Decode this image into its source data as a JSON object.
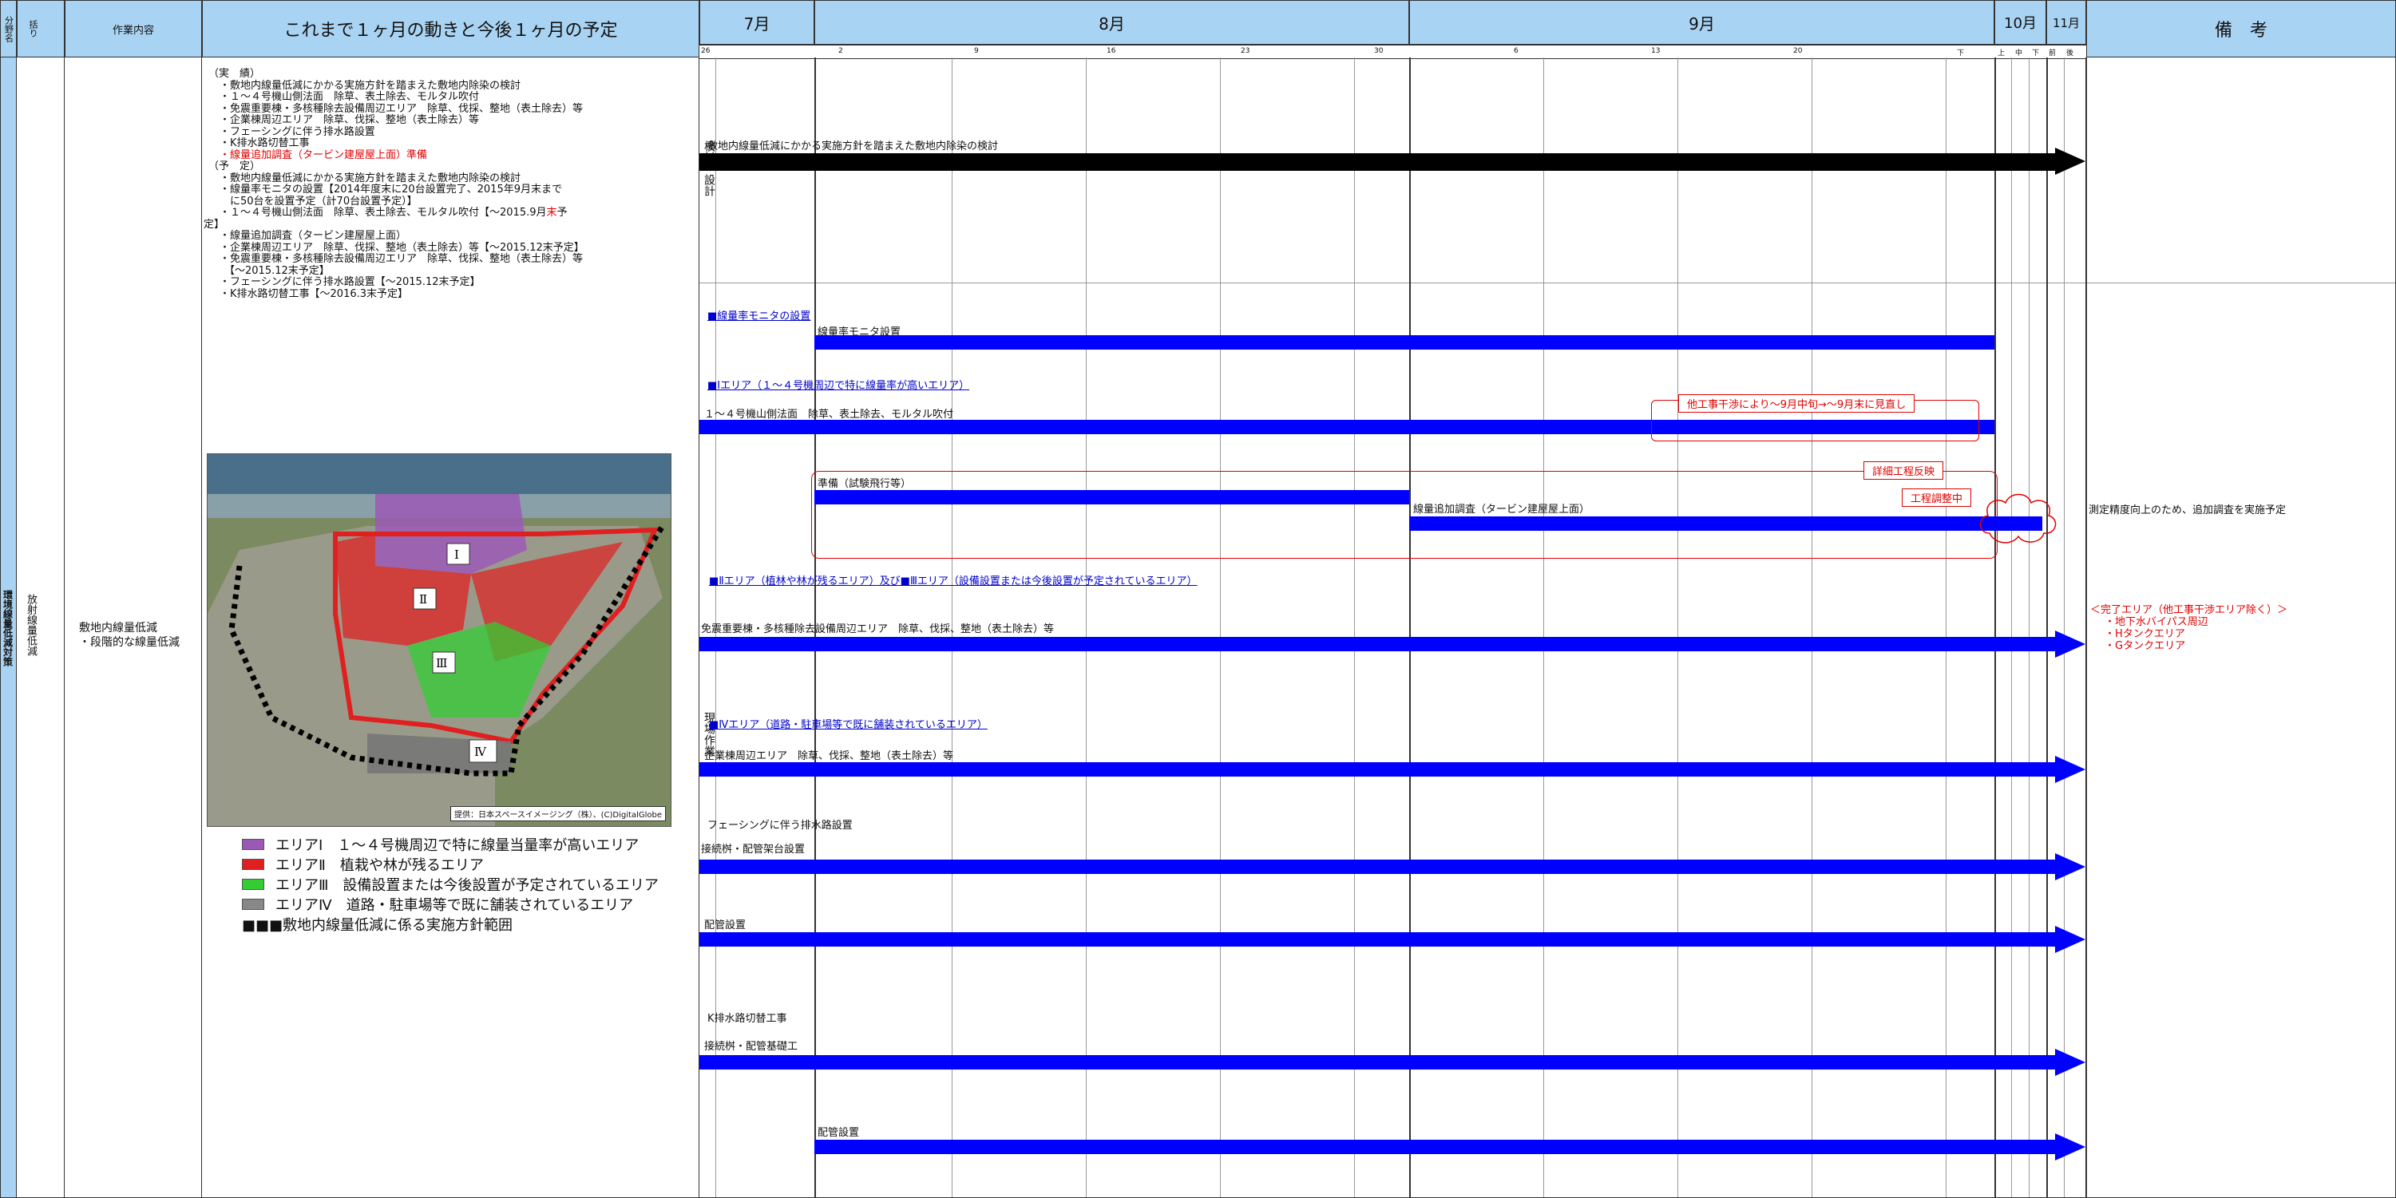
{
  "header": {
    "bunya": "分野名",
    "kubun": "括り",
    "work": "作業内容",
    "plan_title": "これまで１ヶ月の動きと今後１ヶ月の予定",
    "months": [
      "7月",
      "8月",
      "9月",
      "10月",
      "11月"
    ],
    "biko": "備　考",
    "days_jul": "26",
    "days": [
      "2",
      "9",
      "16",
      "23",
      "30",
      "6",
      "13",
      "20"
    ],
    "day_shita": "下",
    "thirds": [
      "上",
      "中",
      "下"
    ],
    "nov": [
      "前",
      "後"
    ]
  },
  "left": {
    "category": "環境線量低減対策",
    "sub": "放射線量低減",
    "work_item": "敷地内線量低減\n・段階的な線量低減"
  },
  "notes": {
    "jisseki_head": "（実　績）",
    "jisseki": [
      "・敷地内線量低減にかかる実施方針を踏まえた敷地内除染の検討",
      "・１～４号機山側法面　除草、表土除去、モルタル吹付",
      "・免震重要棟・多核種除去設備周辺エリア　除草、伐採、整地（表土除去）等",
      "・企業棟周辺エリア　除草、伐採、整地（表土除去）等",
      "・フェーシングに伴う排水路設置",
      "・K排水路切替工事"
    ],
    "jisseki_red": "・線量追加調査（タービン建屋屋上面）準備",
    "yotei_head": "（予　定）",
    "yotei": [
      "・敷地内線量低減にかかる実施方針を踏まえた敷地内除染の検討",
      "・線量率モニタの設置【2014年度末に20台設置完了、2015年9月末まで",
      "　に50台を設置予定（計70台設置予定）】",
      "・１～４号機山側法面　除草、表土除去、モルタル吹付【～2015.9月",
      "定】",
      "・線量追加調査（タービン建屋屋上面）",
      "・企業棟周辺エリア　除草、伐採、整地（表土除去）等【～2015.12末予定】",
      "・免震重要棟・多核種除去設備周辺エリア　除草、伐採、整地（表土除去）等",
      "【～2015.12末予定】",
      "・フェーシングに伴う排水路設置【～2015.12末予定】",
      "・K排水路切替工事【～2016.3末予定】"
    ],
    "yotei_red_char": "末",
    "yotei_after_red": "予"
  },
  "map": {
    "areas": [
      "Ⅰ",
      "Ⅱ",
      "Ⅲ",
      "Ⅳ"
    ],
    "credit": "提供：日本スペースイメージング（株）、(C)DigitalGlobe"
  },
  "legend": [
    {
      "label": "エリアⅠ　１～４号機周辺で特に線量当量率が高いエリア",
      "color": "#9b59b6"
    },
    {
      "label": "エリアⅡ　植栽や林が残るエリア",
      "color": "#e02020"
    },
    {
      "label": "エリアⅢ　設備設置または今後設置が予定されているエリア",
      "color": "#33cc33"
    },
    {
      "label": "エリアⅣ　道路・駐車場等で既に舗装されているエリア",
      "color": "#888888"
    },
    {
      "label": "■■■敷地内線量低減に係る実施方針範囲",
      "color": "#000000"
    }
  ],
  "phase": {
    "kento": "検討・設計",
    "genba": "現場作業"
  },
  "gantt": {
    "t_kento": "敷地内線量低減にかかる実施方針を踏まえた敷地内除染の検討",
    "s_monitor": "■線量率モニタの設置",
    "t_monitor": "線量率モニタ設置",
    "s_area1": "■Ⅰエリア（１～４号機周辺で特に線量率が高いエリア）",
    "t_norimen": "１～４号機山側法面　除草、表土除去、モルタル吹付",
    "red_delay": "他工事干渉により～9月中旬→～9月末に見直し",
    "red_detail": "詳細工程反映",
    "red_adjust": "工程調整中",
    "t_junbi": "準備（試験飛行等）",
    "t_turbine": "線量追加調査（タービン建屋屋上面）",
    "s_area23": "■Ⅱエリア（植林や林が残るエリア）及び■Ⅲエリア（設備設置または今後設置が予定されているエリア）",
    "t_menshin": "免震重要棟・多核種除去設備周辺エリア　除草、伐採、整地（表土除去）等",
    "s_area4": "■Ⅳエリア（道路・駐車場等で既に舗装されているエリア）",
    "t_kigyo": "企業棟周辺エリア　除草、伐採、整地（表土除去）等",
    "t_facing": "フェーシングに伴う排水路設置",
    "t_setsuzoku1": "接続桝・配管架台設置",
    "t_haikan1": "配管設置",
    "t_k": "K排水路切替工事",
    "t_setsuzoku2": "接続桝・配管基礎工",
    "t_haikan2": "配管設置"
  },
  "remarks": {
    "r1": "測定精度向上のため、追加調査を実施予定",
    "r2": "＜完了エリア（他工事干渉エリア除く）＞",
    "r3": "・地下水バイパス周辺",
    "r4": "・Hタンクエリア",
    "r5": "・Gタンクエリア"
  }
}
